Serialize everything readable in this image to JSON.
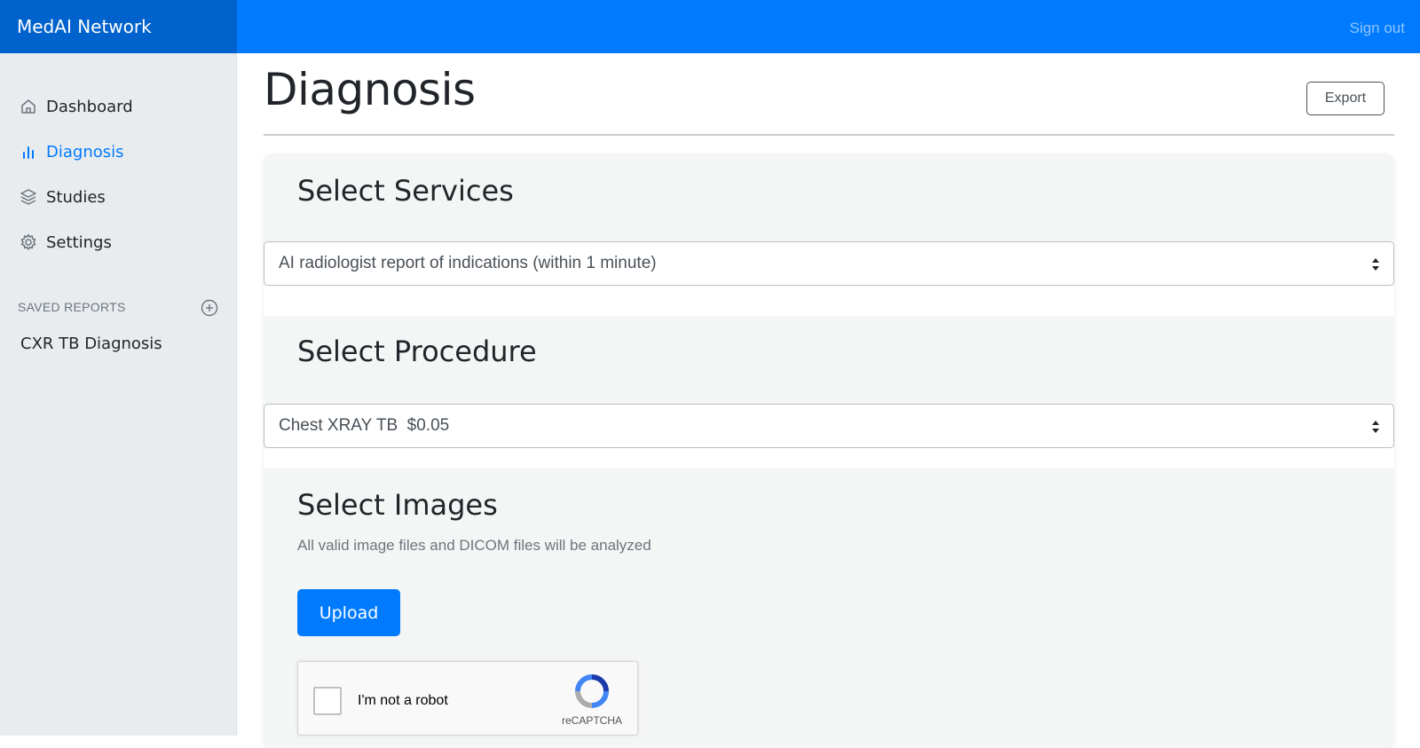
{
  "app": {
    "brand": "MedAI Network",
    "sign_out": "Sign out"
  },
  "sidebar": {
    "items": [
      {
        "label": "Dashboard",
        "icon": "home-icon",
        "active": false
      },
      {
        "label": "Diagnosis",
        "icon": "bar-chart-icon",
        "active": true
      },
      {
        "label": "Studies",
        "icon": "layers-icon",
        "active": false
      },
      {
        "label": "Settings",
        "icon": "gear-icon",
        "active": false
      }
    ],
    "saved_reports_heading": "SAVED REPORTS",
    "saved_reports": [
      "CXR TB Diagnosis"
    ]
  },
  "main": {
    "title": "Diagnosis",
    "export_label": "Export",
    "services": {
      "heading": "Select Services",
      "selected": "AI radiologist report of indications (within 1 minute)"
    },
    "procedure": {
      "heading": "Select Procedure",
      "selected": "Chest XRAY TB  $0.05"
    },
    "images": {
      "heading": "Select Images",
      "hint": "All valid image files and DICOM files will be analyzed",
      "upload_label": "Upload"
    },
    "captcha": {
      "label": "I'm not a robot",
      "brand": "reCAPTCHA"
    }
  },
  "colors": {
    "primary": "#007bff",
    "brand_bg": "#0062cc",
    "sidebar_bg": "#e9ecef"
  }
}
